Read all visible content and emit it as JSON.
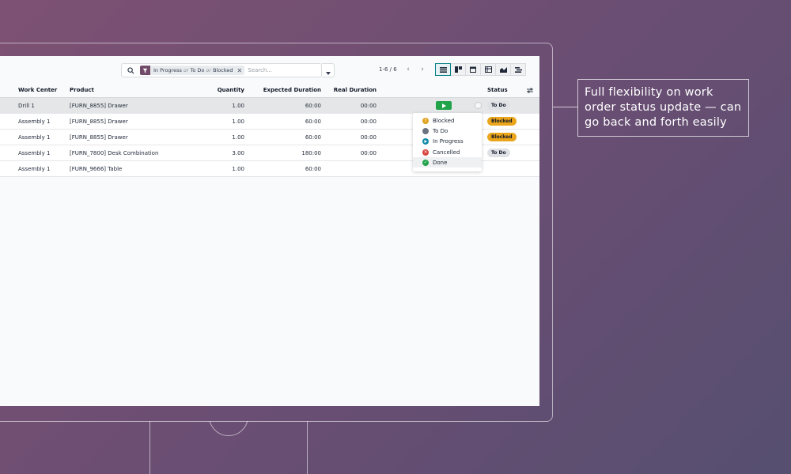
{
  "callout": {
    "text": "Full flexibility on work order status update — can go back and forth easily"
  },
  "search": {
    "facet_parts": [
      "In Progress",
      "or",
      "To Do",
      "or",
      "Blocked"
    ],
    "placeholder": "Search..."
  },
  "pager": {
    "text": "1-6 / 6"
  },
  "views": [
    "list-view-icon",
    "kanban-view-icon",
    "calendar-view-icon",
    "pivot-view-icon",
    "graph-view-icon",
    "gantt-view-icon"
  ],
  "table": {
    "headers": {
      "work_center": "Work Center",
      "product": "Product",
      "quantity": "Quantity",
      "expected_duration": "Expected Duration",
      "real_duration": "Real Duration",
      "status": "Status"
    },
    "rows": [
      {
        "work_center": "Drill 1",
        "product": "[FURN_8855] Drawer",
        "quantity": "1.00",
        "expected_duration": "60:00",
        "real_duration": "00:00",
        "status": "To Do"
      },
      {
        "work_center": "Assembly 1",
        "product": "[FURN_8855] Drawer",
        "quantity": "1.00",
        "expected_duration": "60:00",
        "real_duration": "00:00",
        "status": "Blocked"
      },
      {
        "work_center": "Assembly 1",
        "product": "[FURN_8855] Drawer",
        "quantity": "1.00",
        "expected_duration": "60:00",
        "real_duration": "00:00",
        "status": "Blocked"
      },
      {
        "work_center": "Assembly 1",
        "product": "[FURN_7800] Desk Combination",
        "quantity": "3.00",
        "expected_duration": "180:00",
        "real_duration": "00:00",
        "status": "To Do"
      },
      {
        "work_center": "Assembly 1",
        "product": "[FURN_9666] Table",
        "quantity": "1.00",
        "expected_duration": "60:00",
        "real_duration": "",
        "status": ""
      }
    ]
  },
  "status_menu": {
    "items": [
      {
        "label": "Blocked",
        "icon": "exclamation-icon",
        "color": "#e0a21b"
      },
      {
        "label": "To Do",
        "icon": "circle-icon",
        "color": "#6b7280"
      },
      {
        "label": "In Progress",
        "icon": "play-circle-icon",
        "color": "#0e8ba7"
      },
      {
        "label": "Cancelled",
        "icon": "x-circle-icon",
        "color": "#d9453d"
      },
      {
        "label": "Done",
        "icon": "check-circle-icon",
        "color": "#21a34a"
      }
    ]
  },
  "colors": {
    "brand": "#714b67",
    "accent": "#017e84",
    "success": "#21a34a",
    "warning": "#eaa51b"
  }
}
